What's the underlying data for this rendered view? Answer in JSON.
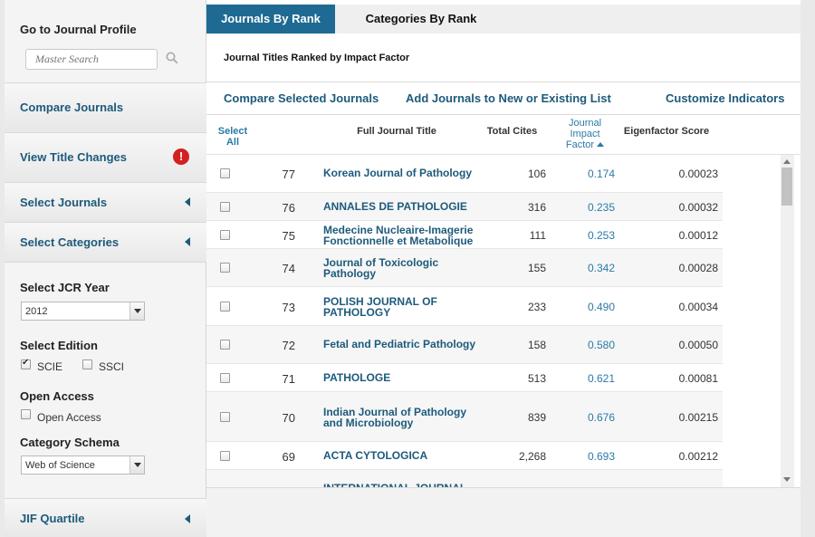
{
  "sidebar": {
    "profile_title": "Go to Journal Profile",
    "search_placeholder": "Master Search",
    "compare": "Compare Journals",
    "title_changes": "View Title Changes",
    "alert_glyph": "!",
    "select_journals": "Select Journals",
    "select_categories": "Select Categories",
    "jcr_year_label": "Select JCR Year",
    "jcr_year_value": "2012",
    "edition_label": "Select Edition",
    "edition_scie": "SCIE",
    "edition_ssci": "SSCI",
    "open_access_label": "Open Access",
    "open_access_option": "Open Access",
    "schema_label": "Category Schema",
    "schema_value": "Web of Science",
    "jif_quartile": "JIF Quartile"
  },
  "tabs": {
    "journals_by_rank": "Journals By Rank",
    "categories_by_rank": "Categories By Rank"
  },
  "panel": {
    "title": "Journal Titles Ranked by Impact Factor"
  },
  "actions": {
    "compare": "Compare Selected Journals",
    "add_list": "Add Journals to New or Existing List",
    "customize": "Customize Indicators"
  },
  "table": {
    "headers": {
      "select_line1": "Select",
      "select_line2": "All",
      "title": "Full Journal Title",
      "cites": "Total Cites",
      "jif_line1": "Journal",
      "jif_line2": "Impact",
      "jif_line3": "Factor",
      "eigen": "Eigenfactor Score"
    },
    "rows": [
      {
        "rank": "77",
        "title1": "Korean Journal of Pathology",
        "title2": "",
        "cites": "106",
        "jif": "0.174",
        "eigen": "0.00023"
      },
      {
        "rank": "76",
        "title1": "ANNALES DE PATHOLOGIE",
        "title2": "",
        "cites": "316",
        "jif": "0.235",
        "eigen": "0.00032"
      },
      {
        "rank": "75",
        "title1": "Medecine Nucleaire-Imagerie",
        "title2": "Fonctionnelle et Metabolique",
        "cites": "111",
        "jif": "0.253",
        "eigen": "0.00012"
      },
      {
        "rank": "74",
        "title1": "Journal of Toxicologic",
        "title2": "Pathology",
        "cites": "155",
        "jif": "0.342",
        "eigen": "0.00028"
      },
      {
        "rank": "73",
        "title1": "POLISH JOURNAL OF",
        "title2": "PATHOLOGY",
        "cites": "233",
        "jif": "0.490",
        "eigen": "0.00034"
      },
      {
        "rank": "72",
        "title1": "Fetal and Pediatric Pathology",
        "title2": "",
        "cites": "158",
        "jif": "0.580",
        "eigen": "0.00050"
      },
      {
        "rank": "71",
        "title1": "PATHOLOGE",
        "title2": "",
        "cites": "513",
        "jif": "0.621",
        "eigen": "0.00081"
      },
      {
        "rank": "70",
        "title1": "Indian Journal of Pathology",
        "title2": "and Microbiology",
        "cites": "839",
        "jif": "0.676",
        "eigen": "0.00215"
      },
      {
        "rank": "69",
        "title1": "ACTA CYTOLOGICA",
        "title2": "",
        "cites": "2,268",
        "jif": "0.693",
        "eigen": "0.00212"
      },
      {
        "rank": "",
        "title1": "INTERNATIONAL JOURNAL",
        "title2": "",
        "cites": "",
        "jif": "",
        "eigen": ""
      }
    ]
  }
}
